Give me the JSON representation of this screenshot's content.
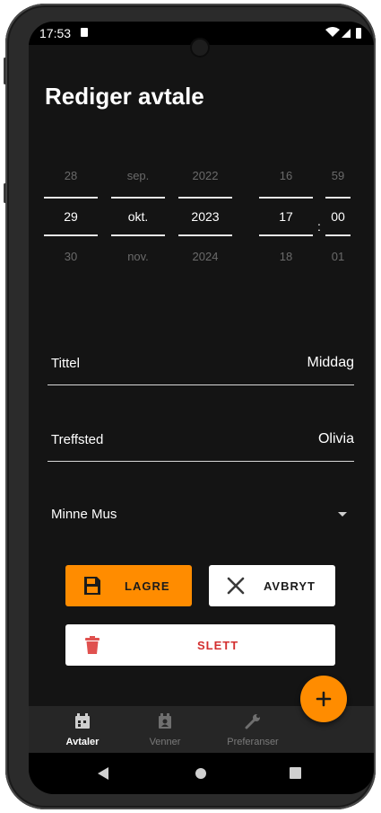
{
  "status": {
    "time": "17:53"
  },
  "header": {
    "title": "Rediger avtale"
  },
  "date_picker": {
    "day": {
      "prev": "28",
      "current": "29",
      "next": "30"
    },
    "month": {
      "prev": "sep.",
      "current": "okt.",
      "next": "nov."
    },
    "year": {
      "prev": "2022",
      "current": "2023",
      "next": "2024"
    },
    "hour": {
      "prev": "16",
      "current": "17",
      "next": "18"
    },
    "minute": {
      "prev": "59",
      "current": "00",
      "next": "01"
    },
    "separator": ":"
  },
  "form": {
    "title_label": "Tittel",
    "title_value": "Middag",
    "place_label": "Treffsted",
    "place_value": "Olivia",
    "friend_selected": "Minne Mus"
  },
  "actions": {
    "save": "LAGRE",
    "cancel": "AVBRYT",
    "delete": "SLETT"
  },
  "bottom_nav": [
    {
      "label": "Avtaler",
      "icon": "calendar-icon",
      "active": true
    },
    {
      "label": "Venner",
      "icon": "friends-icon",
      "active": false
    },
    {
      "label": "Preferanser",
      "icon": "wrench-icon",
      "active": false
    }
  ],
  "colors": {
    "accent": "#ff8c00",
    "danger": "#d32f2f",
    "background": "#141414"
  }
}
